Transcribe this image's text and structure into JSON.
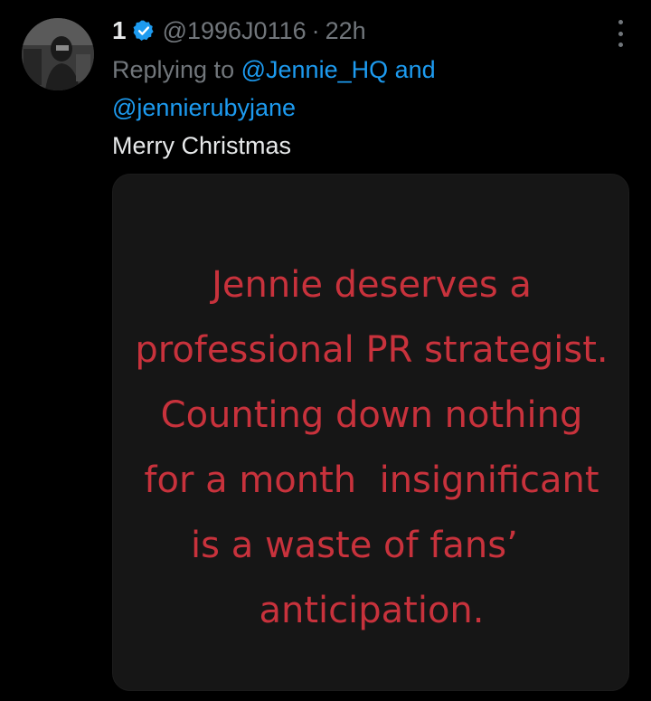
{
  "tweet": {
    "display_name": "1",
    "handle": "@1996J0116",
    "separator": "·",
    "time": "22h",
    "verified": true,
    "replying_to": {
      "prefix": "Replying to",
      "mentions": [
        "@Jennie_HQ",
        "@jennierubyjane"
      ],
      "conjunction": "and"
    },
    "text": "Merry Christmas",
    "image_text_lines": [
      "Jennie deserves a",
      "professional PR strategist.",
      "Counting down nothing",
      "for a month  insignificant",
      "is a waste of fans’   ",
      "anticipation."
    ]
  },
  "colors": {
    "background": "#000000",
    "primary_text": "#e7e9ea",
    "secondary_text": "#71767b",
    "link": "#1d9bf0",
    "image_text": "#c8323c",
    "image_background": "#161616"
  },
  "icons": {
    "verified": "verified-badge-icon",
    "more": "more-dots-icon"
  }
}
